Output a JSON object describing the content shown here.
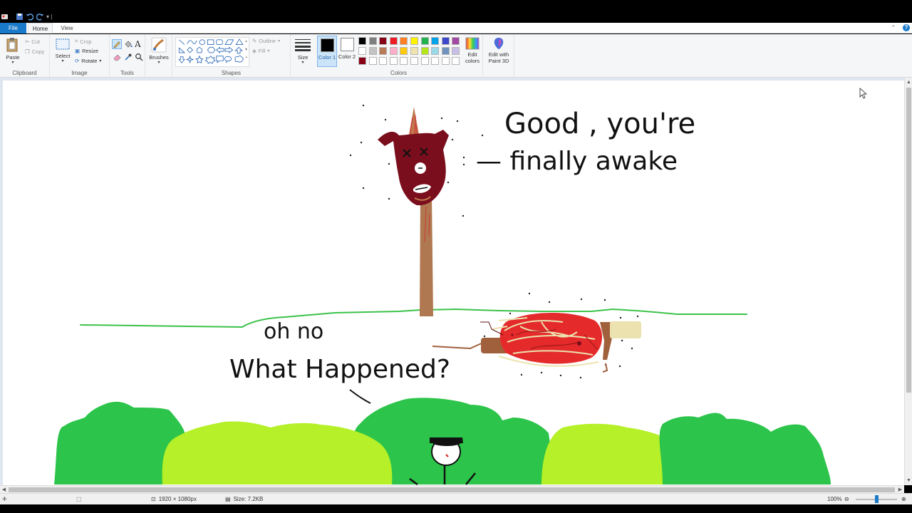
{
  "ribbon": {
    "tabs": [
      "File",
      "Home",
      "View"
    ],
    "clipboard": {
      "paste": "Paste",
      "cut": "Cut",
      "copy": "Copy",
      "label": "Clipboard"
    },
    "image": {
      "select": "Select",
      "crop": "Crop",
      "resize": "Resize",
      "rotate": "Rotate",
      "label": "Image"
    },
    "tools": {
      "label": "Tools"
    },
    "brushes": {
      "label": "Brushes"
    },
    "shapes": {
      "outline": "Outline",
      "fill": "Fill",
      "label": "Shapes"
    },
    "size": {
      "label": "Size"
    },
    "color1": {
      "label": "Color 1",
      "value": "#000000"
    },
    "color2": {
      "label": "Color 2",
      "value": "#ffffff"
    },
    "colors": {
      "label": "Colors",
      "row1": [
        "#000000",
        "#7f7f7f",
        "#880015",
        "#ed1c24",
        "#ff7f27",
        "#fff200",
        "#22b14c",
        "#00a2e8",
        "#3f48cc",
        "#a349a4"
      ],
      "row2": [
        "#ffffff",
        "#c3c3c3",
        "#b97a57",
        "#ffaec9",
        "#ffc90e",
        "#efe4b0",
        "#b5e61d",
        "#99d9ea",
        "#7092be",
        "#c8bfe7"
      ],
      "row3": [
        "#880015",
        "#ffffff",
        "#ffffff",
        "#ffffff",
        "#ffffff",
        "#ffffff",
        "#ffffff",
        "#ffffff",
        "#ffffff",
        "#ffffff"
      ]
    },
    "edit_colors": "Edit colors",
    "paint3d": "Edit with Paint 3D"
  },
  "drawing": {
    "speech_top": [
      "Good , you're",
      "— finally awake"
    ],
    "speech_bottom": [
      "oh no",
      "What Happened?"
    ]
  },
  "status": {
    "dimensions": "1920 × 1080px",
    "size": "Size: 7.2KB",
    "zoom": "100%"
  }
}
